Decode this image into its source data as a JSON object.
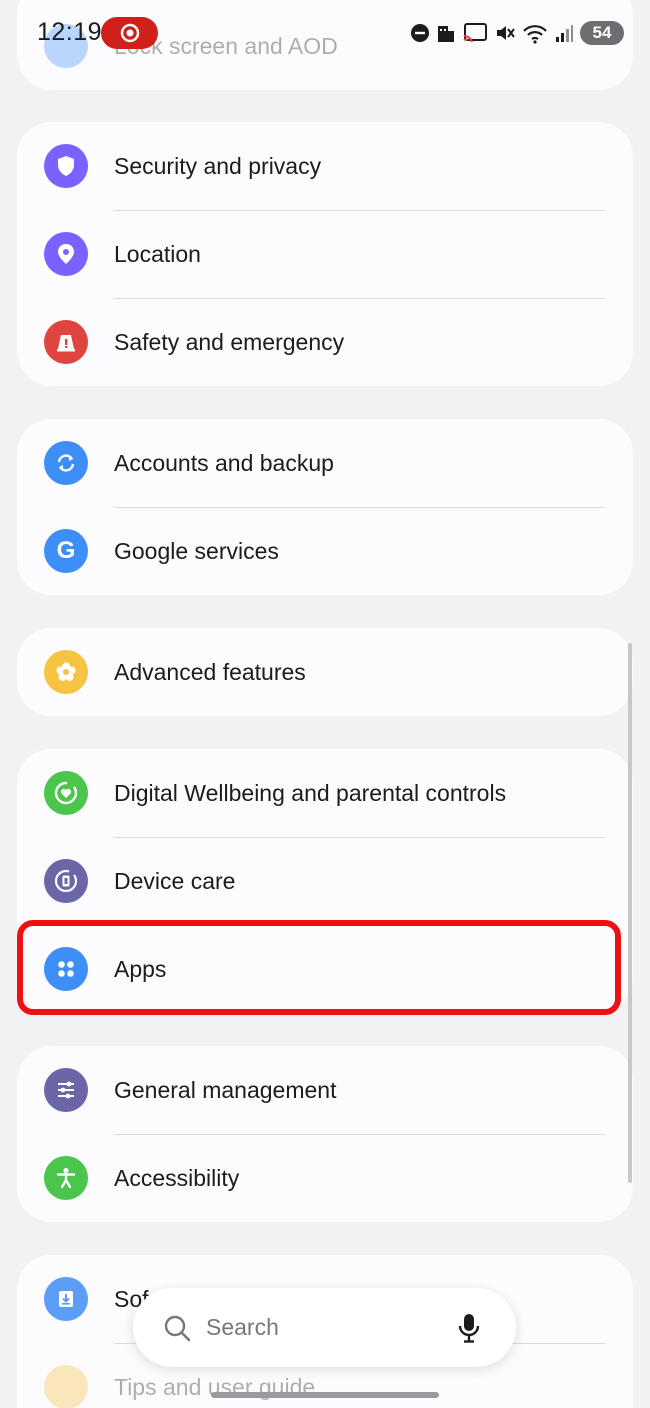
{
  "status_bar": {
    "time": "12:19",
    "battery": "54"
  },
  "top_item": {
    "label": "Lock screen and AOD"
  },
  "groups": [
    {
      "items": [
        {
          "label": "Security and privacy",
          "icon": "shield-icon",
          "color": "#7b61ff"
        },
        {
          "label": "Location",
          "icon": "location-pin-icon",
          "color": "#7b61ff"
        },
        {
          "label": "Safety and emergency",
          "icon": "warning-icon",
          "color": "#e0443e"
        }
      ]
    },
    {
      "items": [
        {
          "label": "Accounts and backup",
          "icon": "sync-icon",
          "color": "#3e8ef7"
        },
        {
          "label": "Google services",
          "icon": "google-g-icon",
          "color": "#3e8ef7"
        }
      ]
    },
    {
      "items": [
        {
          "label": "Advanced features",
          "icon": "flower-gear-icon",
          "color": "#f6c342"
        }
      ]
    },
    {
      "items": [
        {
          "label": "Digital Wellbeing and parental controls",
          "icon": "heart-ring-icon",
          "color": "#4cc54c"
        },
        {
          "label": "Device care",
          "icon": "device-care-icon",
          "color": "#6a66a8"
        },
        {
          "label": "Apps",
          "icon": "apps-dots-icon",
          "color": "#3e8ef7"
        }
      ]
    },
    {
      "items": [
        {
          "label": "General management",
          "icon": "sliders-icon",
          "color": "#6a66a8"
        },
        {
          "label": "Accessibility",
          "icon": "accessibility-icon",
          "color": "#4cc54c"
        }
      ]
    },
    {
      "items": [
        {
          "label": "Sof",
          "icon": "software-update-icon",
          "color": "#3e8ef7"
        },
        {
          "label": "Tips and user guide",
          "icon": "tips-icon",
          "color": "#f6c342"
        }
      ]
    }
  ],
  "search": {
    "placeholder": "Search"
  },
  "highlight_color": "#ee1111"
}
